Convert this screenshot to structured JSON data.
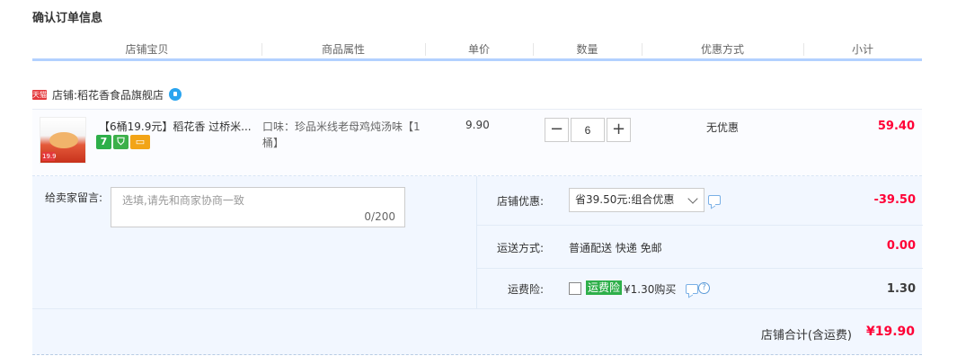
{
  "page": {
    "title": "确认订单信息"
  },
  "table_header": [
    "店铺宝贝",
    "商品属性",
    "单价",
    "数量",
    "优惠方式",
    "小计"
  ],
  "shop": {
    "badge": "天猫",
    "label": "店铺: ",
    "name": "稻花香食品旗舰店",
    "chat_icon": "wangwang-chat-icon"
  },
  "item": {
    "title": "【6桶19.9元】稻花香 过桥米...",
    "thumb_badge": "19.9",
    "service_icons": [
      "seven-day-return-icon",
      "shield-guarantee-icon",
      "card-payment-icon"
    ],
    "attribute": "口味：珍品米线老母鸡炖汤味【1桶】",
    "unit_price": "9.90",
    "quantity": "6",
    "qty_minus": "−",
    "qty_plus": "+",
    "promotion": "无优惠",
    "subtotal": "59.40"
  },
  "message": {
    "label": "给卖家留言:",
    "placeholder": "选填,请先和商家协商一致",
    "counter": "0/200"
  },
  "shop_discount": {
    "label": "店铺优惠:",
    "selected": "省39.50元:组合优惠",
    "amount": "-39.50"
  },
  "shipping": {
    "label": "运送方式:",
    "method": "普通配送 快递 免邮",
    "fee": "0.00"
  },
  "insurance": {
    "label": "运费险:",
    "badge": "运费险",
    "price_text": "¥1.30购买",
    "help": "?",
    "fee": "1.30",
    "checked": false
  },
  "total": {
    "label": "店铺合计(含运费)",
    "value": "¥19.90"
  },
  "colors": {
    "price_red": "#ff0036",
    "header_border": "#b2d1ff",
    "panel_bg": "#f2f7ff",
    "green_badge": "#2eaf4a"
  }
}
